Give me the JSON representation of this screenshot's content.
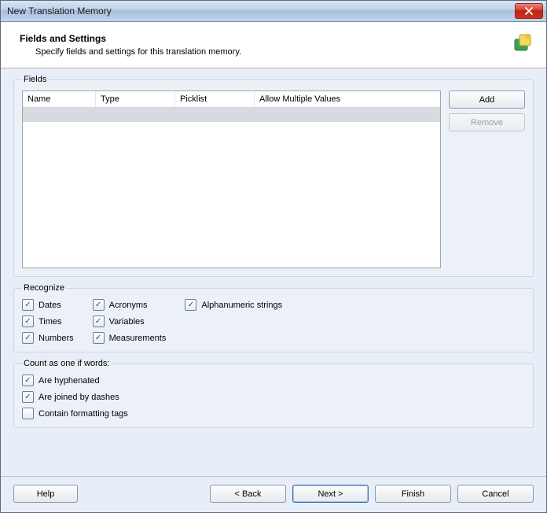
{
  "titlebar": {
    "title": "New Translation Memory"
  },
  "header": {
    "title": "Fields and Settings",
    "subtitle": "Specify fields and settings for this translation memory."
  },
  "fields_group": {
    "label": "Fields",
    "columns": {
      "name": "Name",
      "type": "Type",
      "picklist": "Picklist",
      "amv": "Allow Multiple Values"
    },
    "buttons": {
      "add": "Add",
      "remove": "Remove"
    }
  },
  "recognize_group": {
    "label": "Recognize",
    "items": {
      "dates": "Dates",
      "times": "Times",
      "numbers": "Numbers",
      "acronyms": "Acronyms",
      "variables": "Variables",
      "measurements": "Measurements",
      "alphanumeric": "Alphanumeric strings"
    }
  },
  "count_group": {
    "label": "Count as one if words:",
    "items": {
      "hyphenated": "Are hyphenated",
      "dashes": "Are joined by dashes",
      "formatting": "Contain formatting tags"
    }
  },
  "footer": {
    "help": "Help",
    "back": "< Back",
    "next": "Next >",
    "finish": "Finish",
    "cancel": "Cancel"
  }
}
